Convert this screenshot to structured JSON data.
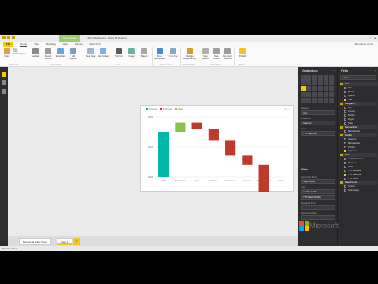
{
  "window": {
    "title": "Fifth Order Report - Power BI Desktop",
    "context_tab": "Visual Tools",
    "controls": [
      "–",
      "□",
      "✕"
    ]
  },
  "ribbon": {
    "tabs": [
      "File",
      "Home",
      "View",
      "Modeling",
      "Help",
      "Format",
      "Data / Drill"
    ],
    "active_tab": "Home",
    "signin": "Bernadette Curtis",
    "groups": [
      {
        "label": "Clipboard",
        "buttons": [
          "Paste",
          "Cut",
          "Copy",
          "Format Painter"
        ]
      },
      {
        "label": "External data",
        "buttons": [
          "Get Data",
          "Recent Sources",
          "Enter Data",
          "Edit Queries"
        ]
      },
      {
        "label": "Insert",
        "buttons": [
          "New Page",
          "New Visual",
          "Text box",
          "Image",
          "Shapes"
        ]
      },
      {
        "label": "Custom visuals",
        "buttons": [
          "From Marketplace",
          "From File"
        ]
      },
      {
        "label": "Relationships",
        "buttons": [
          "Manage Relationships"
        ]
      },
      {
        "label": "Calculations",
        "buttons": [
          "New Measure",
          "New Column",
          "New Quick Measure"
        ]
      },
      {
        "label": "Share",
        "buttons": [
          "Publish"
        ]
      }
    ]
  },
  "visual": {
    "legend": [
      {
        "label": "Increase",
        "color": "#01b8aa"
      },
      {
        "label": "Decrease",
        "color": "#c0392b"
      },
      {
        "label": "Total",
        "color": "#8bc34a"
      }
    ],
    "header_icons": [
      "◰",
      "···"
    ]
  },
  "chart_data": {
    "type": "bar",
    "subtype": "waterfall",
    "categories": [
      "2009",
      "Accessories",
      "Bikes",
      "Clothing",
      "Components",
      "Helmets",
      "Tires and Tubes",
      "2010"
    ],
    "values": [
      1.5,
      0.3,
      -0.2,
      -0.4,
      -0.5,
      -0.3,
      -1.4,
      -0.9
    ],
    "colors": [
      "#01b8aa",
      "#8bc34a",
      "#c0392b",
      "#c0392b",
      "#c0392b",
      "#c0392b",
      "#c0392b",
      "#01b8aa"
    ],
    "ytick_labels": [
      "$2M",
      "$1M",
      "$0M"
    ],
    "ylim": [
      0,
      2
    ]
  },
  "page_tabs": {
    "nav": [
      "‹",
      "›"
    ],
    "tabs": [
      "Behavioral Sales Week",
      "Page 1"
    ],
    "active": "Page 1",
    "add_label": "+"
  },
  "status": "PAGE 1 OF 1",
  "visualizations": {
    "title": "Visualizations",
    "collapse": "›",
    "wells": [
      {
        "label": "Category",
        "value": "Year"
      },
      {
        "label": "Breakdown",
        "value": "Segment"
      },
      {
        "label": "Y Axis",
        "value": "YTD Sales Var"
      }
    ]
  },
  "filters": {
    "title": "Filters",
    "items": [
      {
        "label": "Visual level filters",
        "value": "Segment(All)"
      },
      {
        "label": "Year",
        "value": "is 2009 or 2010"
      },
      {
        "label": "",
        "value": "YTD Sales Var(All)"
      },
      {
        "label": "Page level filters",
        "value": ""
      },
      {
        "label": "Report level filters",
        "value": ""
      }
    ]
  },
  "fields": {
    "title": "Fields",
    "collapse": "›",
    "search_placeholder": "Search",
    "list": [
      {
        "kind": "table",
        "label": "Date"
      },
      {
        "kind": "field",
        "label": "Date"
      },
      {
        "kind": "field",
        "label": "Month"
      },
      {
        "kind": "field",
        "label": "Quarter"
      },
      {
        "kind": "field",
        "label": "Year",
        "checked": true
      },
      {
        "kind": "table",
        "label": "Geography"
      },
      {
        "kind": "field",
        "label": "City"
      },
      {
        "kind": "field",
        "label": "Country"
      },
      {
        "kind": "field",
        "label": "Division"
      },
      {
        "kind": "field",
        "label": "Region"
      },
      {
        "kind": "field",
        "label": "State"
      },
      {
        "kind": "table",
        "label": "Manufacturer"
      },
      {
        "kind": "field",
        "label": "Manufacturer"
      },
      {
        "kind": "table",
        "label": "Product"
      },
      {
        "kind": "field",
        "label": "Category"
      },
      {
        "kind": "field",
        "label": "Manufacturer"
      },
      {
        "kind": "field",
        "label": "Product"
      },
      {
        "kind": "field",
        "label": "Segment",
        "checked": true
      },
      {
        "kind": "table",
        "label": "Sales"
      },
      {
        "kind": "field",
        "label": "LY YTD Revenue"
      },
      {
        "kind": "field",
        "label": "Revenue"
      },
      {
        "kind": "field",
        "label": "Units"
      },
      {
        "kind": "field",
        "label": "YTD Revenue"
      },
      {
        "kind": "field",
        "label": "YTD Sales Var",
        "checked": true
      },
      {
        "kind": "field",
        "label": "YTD Units"
      },
      {
        "kind": "table",
        "label": "Sales Funnel"
      },
      {
        "kind": "field",
        "label": "Amount"
      },
      {
        "kind": "field",
        "label": "Sales Stage"
      }
    ]
  },
  "watermark": "Microsoft"
}
